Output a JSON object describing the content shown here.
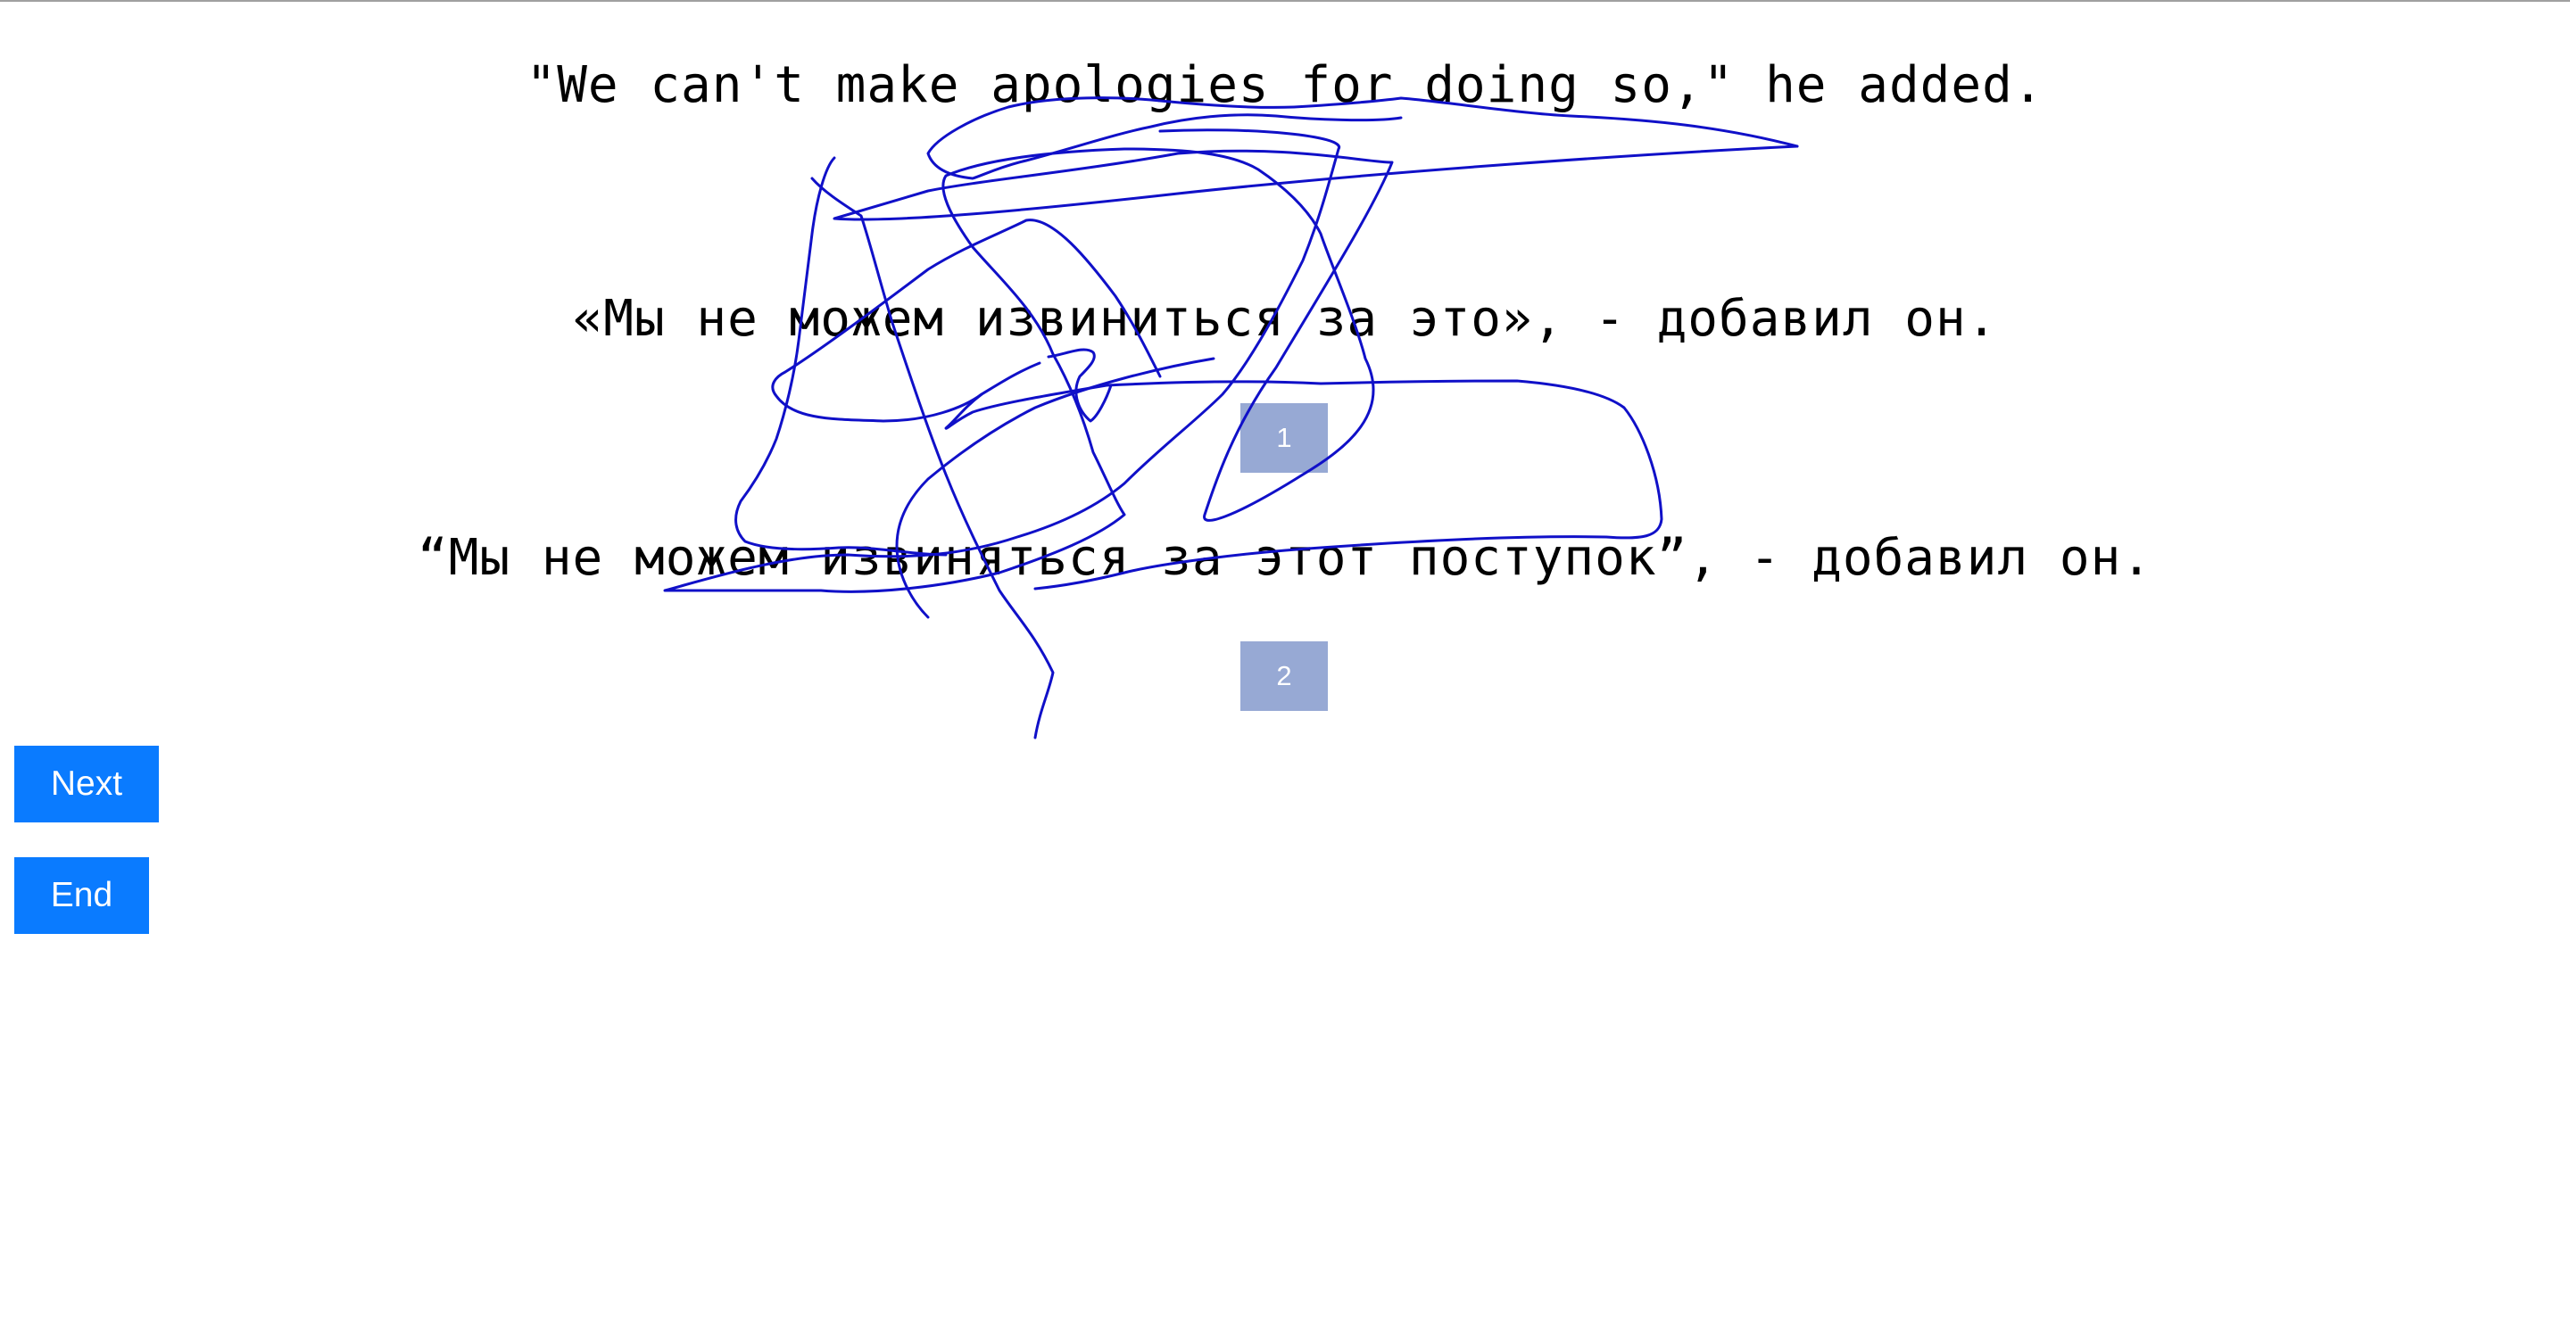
{
  "source": {
    "text": "\"We can't make apologies for doing so,\" he added."
  },
  "translations": [
    {
      "text": "«Мы не можем извиниться за это», - добавил он.",
      "choice_label": "1"
    },
    {
      "text": "“Мы не можем извиняться за этот поступок”, - добавил он.",
      "choice_label": "2"
    }
  ],
  "controls": {
    "next_label": "Next",
    "end_label": "End"
  },
  "colors": {
    "button": "#0a7bff",
    "choice_box": "#97a9d4",
    "scribble": "#1010c8"
  },
  "icons": {
    "freehand_annotation": "scribble-stroke"
  }
}
